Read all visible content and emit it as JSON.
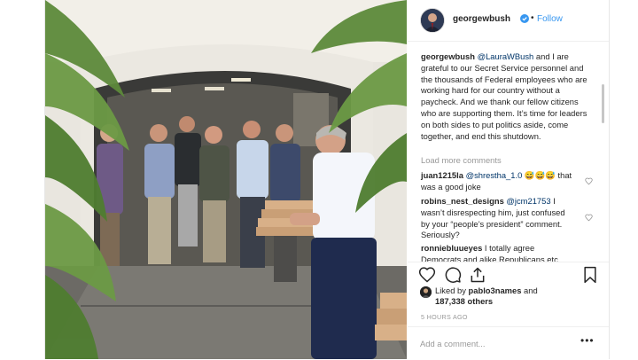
{
  "post": {
    "username": "georgewbush",
    "follow_label": "Follow",
    "separator": "•",
    "caption_user": "georgewbush",
    "caption_mention": "@LauraWBush",
    "caption_text": " and I are grateful to our Secret Service personnel and the thousands of Federal employees who are working hard for our country without a paycheck. And we thank our fellow citizens who are supporting them. It’s time for leaders on both sides to put politics aside, come together, and end this shutdown.",
    "load_more": "Load more comments",
    "comments": [
      {
        "user": "juan1215la",
        "mention": "@shrestha_1.0",
        "text": " 😅😅😅 that was a good joke"
      },
      {
        "user": "robins_nest_designs",
        "mention": "@jcm21753",
        "text": " I wasn’t disrespecting him, just confused by your “people’s president” comment. Seriously?"
      },
      {
        "user": "ronniebluueyes",
        "mention": "",
        "text": " I totally agree Democrats and alike Republicans etc"
      }
    ],
    "liked_prefix": "Liked by ",
    "liked_user": "pablo3names",
    "liked_and": " and",
    "liked_count": "187,338 others",
    "timestamp": "5 HOURS AGO",
    "add_comment_placeholder": "Add a comment...",
    "more_label": "•••"
  },
  "icons": {
    "verified": "verified-badge-icon",
    "like": "heart-icon",
    "comment": "comment-icon",
    "share": "share-icon",
    "save": "bookmark-icon",
    "more": "more-options-icon"
  },
  "colors": {
    "link_blue": "#3897f0",
    "mention": "#003569",
    "meta_gray": "#999999",
    "text": "#262626"
  }
}
